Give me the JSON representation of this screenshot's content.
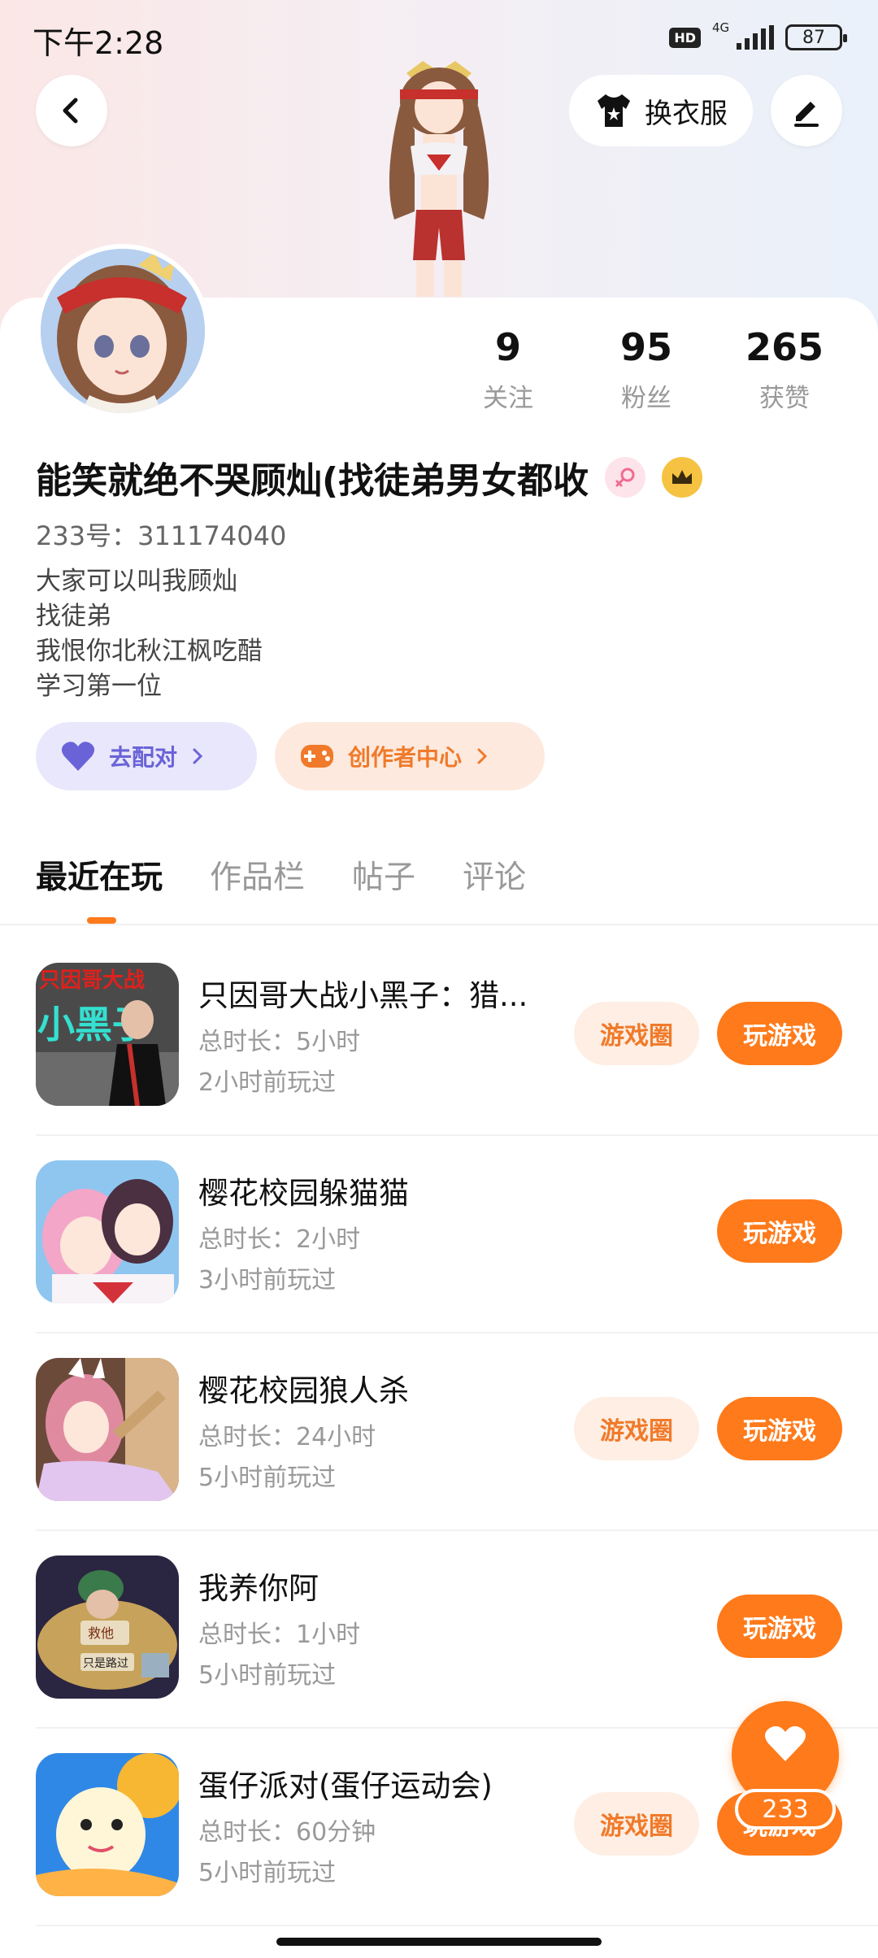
{
  "status_bar": {
    "time": "下午2:28",
    "hd": "HD",
    "network": "4G",
    "battery": "87"
  },
  "header": {
    "dress_button_label": "换衣服"
  },
  "profile": {
    "stats": [
      {
        "value": "9",
        "label": "关注"
      },
      {
        "value": "95",
        "label": "粉丝"
      },
      {
        "value": "265",
        "label": "获赞"
      }
    ],
    "nickname": "能笑就绝不哭顾灿(找徒弟男女都收",
    "uid": "233号：311174040",
    "bio_lines": [
      "大家可以叫我顾灿",
      "找徒弟",
      "我恨你北秋江枫吃醋",
      "学习第一位"
    ]
  },
  "actions": {
    "match_label": "去配对",
    "creator_label": "创作者中心"
  },
  "tabs": [
    {
      "label": "最近在玩",
      "active": true
    },
    {
      "label": "作品栏",
      "active": false
    },
    {
      "label": "帖子",
      "active": false
    },
    {
      "label": "评论",
      "active": false
    }
  ],
  "games": [
    {
      "title": "只因哥大战小黑子：猎...",
      "duration": "总时长：5小时",
      "last_played": "2小时前玩过",
      "circle_label": "游戏圈",
      "play_label": "玩游戏",
      "icon": "game-icon-xiaoheizi"
    },
    {
      "title": "樱花校园躲猫猫",
      "duration": "总时长：2小时",
      "last_played": "3小时前玩过",
      "circle_label": "",
      "play_label": "玩游戏",
      "icon": "game-icon-sakura-hide"
    },
    {
      "title": "樱花校园狼人杀",
      "duration": "总时长：24小时",
      "last_played": "5小时前玩过",
      "circle_label": "游戏圈",
      "play_label": "玩游戏",
      "icon": "game-icon-sakura-werewolf"
    },
    {
      "title": "我养你阿",
      "duration": "总时长：1小时",
      "last_played": "5小时前玩过",
      "circle_label": "",
      "play_label": "玩游戏",
      "icon": "game-icon-woyangnia"
    },
    {
      "title": "蛋仔派对(蛋仔运动会)",
      "duration": "总时长：60分钟",
      "last_played": "5小时前玩过",
      "circle_label": "游戏圈",
      "play_label": "玩游戏",
      "icon": "game-icon-eggy-party"
    }
  ],
  "game_icon_texts": {
    "xiaoheizi_line1": "只因哥大战",
    "xiaoheizi_line2": "小黑子",
    "woyangnia_sign": "只是路过",
    "woyangnia_sign2": "救他"
  },
  "fab": {
    "count": "233"
  },
  "colors": {
    "accent": "#ff7a1a",
    "match": "#6a63d8",
    "creator": "#f07a2a"
  }
}
